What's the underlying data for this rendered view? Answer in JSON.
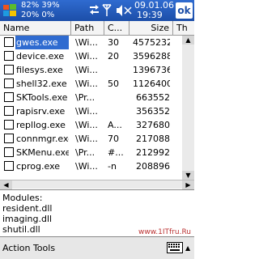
{
  "status": {
    "battery1": "82% 39%",
    "battery2": "20% 0%",
    "date": "09.01.06",
    "time": "19:39",
    "ok_label": "ok"
  },
  "table": {
    "columns": [
      "Name",
      "Path",
      "C...",
      "Size",
      "Th"
    ],
    "rows": [
      {
        "name": "gwes.exe",
        "path": "\\Wi...",
        "c": "30",
        "size": "4575232",
        "selected": true
      },
      {
        "name": "device.exe",
        "path": "\\Wi...",
        "c": "20",
        "size": "3596288"
      },
      {
        "name": "filesys.exe",
        "path": "\\Wi...",
        "c": "",
        "size": "1396736"
      },
      {
        "name": "shell32.exe",
        "path": "\\Wi...",
        "c": "50",
        "size": "1126400"
      },
      {
        "name": "SKTools.exe",
        "path": "\\Pr...",
        "c": "",
        "size": "663552"
      },
      {
        "name": "rapisrv.exe",
        "path": "\\Wi...",
        "c": "",
        "size": "356352"
      },
      {
        "name": "repllog.exe",
        "path": "\\Wi...",
        "c": "A...",
        "size": "327680"
      },
      {
        "name": "connmgr.exe",
        "path": "\\Wi...",
        "c": "70",
        "size": "217088"
      },
      {
        "name": "SKMenu.exe",
        "path": "\\Pr...",
        "c": "#...",
        "size": "212992"
      },
      {
        "name": "cprog.exe",
        "path": "\\Wi...",
        "c": "-n",
        "size": "208896"
      }
    ]
  },
  "modules": {
    "label": "Modules:",
    "items": [
      "resident.dll",
      "imaging.dll",
      "shutil.dll"
    ]
  },
  "watermark": "www.1ITfru.Ru",
  "menubar": {
    "label": "Action Tools"
  },
  "colors": {
    "title_bar": "#1c4ea8",
    "selection": "#2f6bd0"
  }
}
